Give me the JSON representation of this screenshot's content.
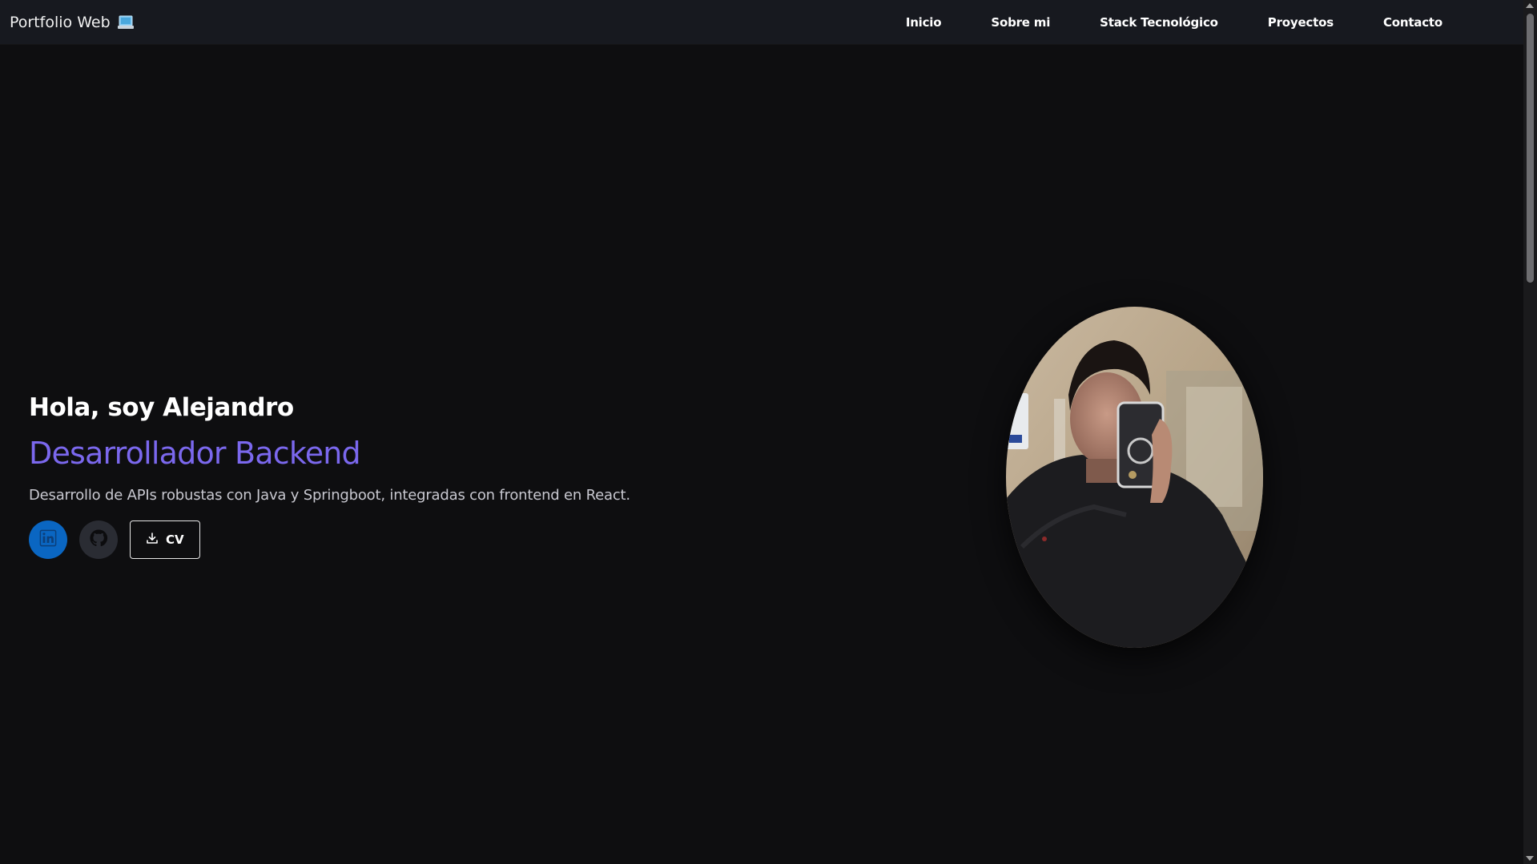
{
  "navbar": {
    "brand": "Portfolio Web",
    "brand_icon": "laptop-icon",
    "links": [
      "Inicio",
      "Sobre mi",
      "Stack Tecnológico",
      "Proyectos",
      "Contacto"
    ]
  },
  "hero": {
    "greeting": "Hola, soy Alejandro",
    "role": "Desarrollador Backend",
    "description": "Desarrollo de APIs robustas con Java y Springboot, integradas con frontend en React.",
    "actions": {
      "linkedin_icon": "linkedin-icon",
      "github_icon": "github-icon",
      "cv_label": "CV",
      "cv_icon": "download-icon"
    },
    "avatar_icon": "profile-photo"
  },
  "colors": {
    "background": "#0e0e10",
    "navbar": "#17191f",
    "accent": "#7b68ee",
    "linkedin": "#0a66c2",
    "github": "#2a2c33"
  }
}
